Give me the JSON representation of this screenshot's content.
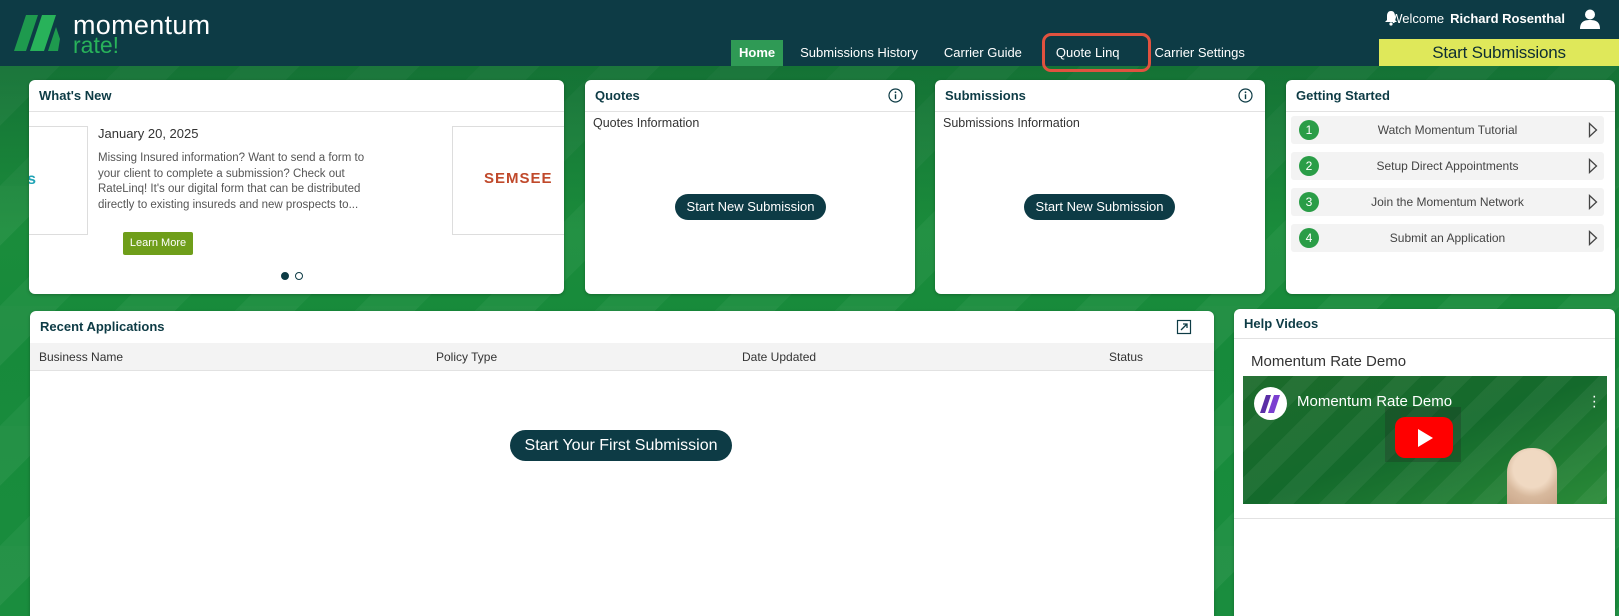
{
  "header": {
    "logo_line1": "momentum",
    "logo_line2": "rate!",
    "welcome_prefix": "Welcome",
    "user_name": "Richard Rosenthal",
    "start_submissions": "Start Submissions",
    "nav": [
      {
        "label": "Home",
        "active": true
      },
      {
        "label": "Submissions History"
      },
      {
        "label": "Carrier Guide"
      },
      {
        "label": "Quote Linq",
        "highlighted": true
      },
      {
        "label": "Carrier Settings"
      }
    ]
  },
  "whats_new": {
    "title": "What's New",
    "left_image_fragment": "s",
    "date": "January 20, 2025",
    "body": "Missing Insured information? Want to send a form to your client to complete a submission? Check out RateLinq! It's our digital form that can be distributed directly to existing insureds and new prospects to...",
    "learn_more": "Learn More",
    "right_image_text": "SEMSEE",
    "slide_count": 2,
    "active_slide": 1
  },
  "quotes": {
    "title": "Quotes",
    "subtitle": "Quotes Information",
    "button": "Start New Submission"
  },
  "submissions": {
    "title": "Submissions",
    "subtitle": "Submissions Information",
    "button": "Start New Submission"
  },
  "getting_started": {
    "title": "Getting Started",
    "items": [
      {
        "num": "1",
        "label": "Watch Momentum Tutorial"
      },
      {
        "num": "2",
        "label": "Setup Direct Appointments"
      },
      {
        "num": "3",
        "label": "Join the Momentum Network"
      },
      {
        "num": "4",
        "label": "Submit an Application"
      }
    ]
  },
  "recent_apps": {
    "title": "Recent Applications",
    "columns": [
      "Business Name",
      "Policy Type",
      "Date Updated",
      "Status"
    ],
    "empty_button": "Start Your First Submission"
  },
  "help_videos": {
    "title": "Help Videos",
    "video_title": "Momentum Rate Demo",
    "video_overlay_title": "Momentum Rate Demo"
  },
  "colors": {
    "header_bg": "#0d3b45",
    "accent_green": "#28b25a",
    "start_submissions_bg": "#dfe85a",
    "highlight_border": "#e0523f"
  }
}
